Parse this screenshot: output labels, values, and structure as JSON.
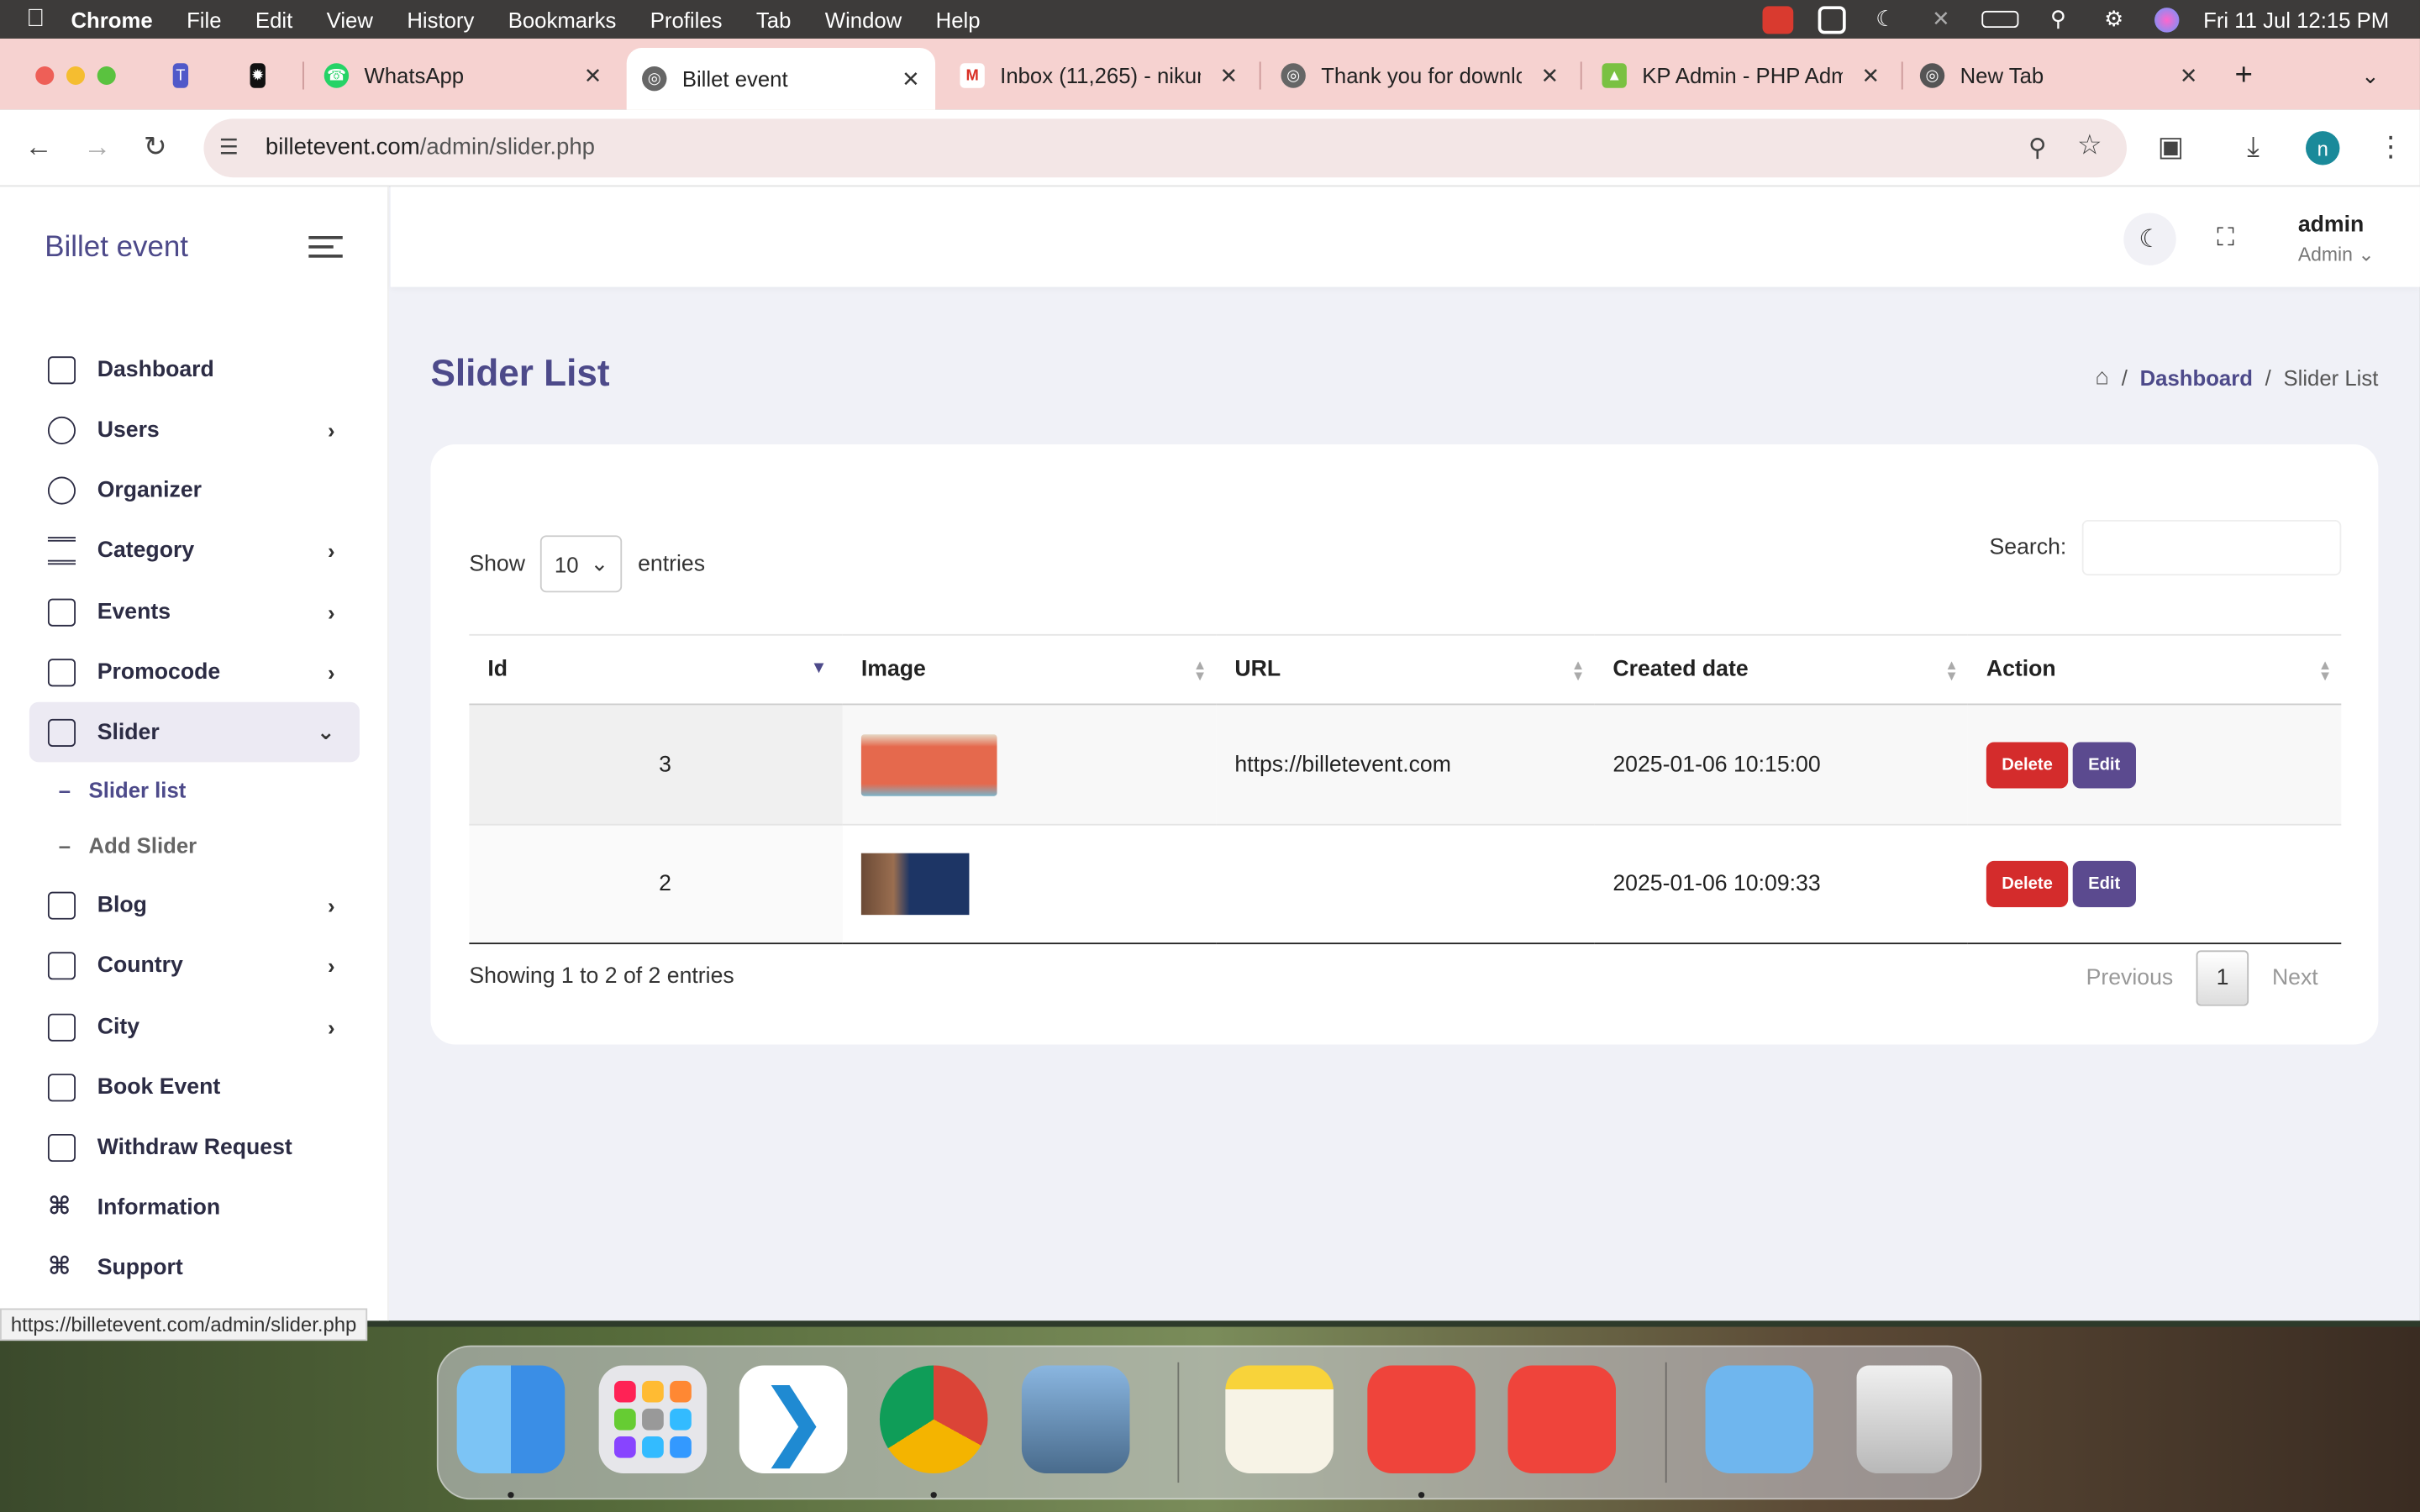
{
  "menubar": {
    "app": "Chrome",
    "items": [
      "File",
      "Edit",
      "View",
      "History",
      "Bookmarks",
      "Profiles",
      "Tab",
      "Window",
      "Help"
    ],
    "datetime": "Fri 11 Jul  12:15 PM"
  },
  "tabs": [
    {
      "label": "WhatsApp"
    },
    {
      "label": "Billet event"
    },
    {
      "label": "Inbox (11,265) - nikun"
    },
    {
      "label": "Thank you for downlo"
    },
    {
      "label": "KP Admin - PHP Adm"
    },
    {
      "label": "New Tab"
    }
  ],
  "browser": {
    "url_host": "billetevent.com",
    "url_path": "/admin/slider.php",
    "profile_initial": "n",
    "status_url": "https://billetevent.com/admin/slider.php"
  },
  "sidebar": {
    "brand": "Billet event",
    "items": [
      {
        "label": "Dashboard"
      },
      {
        "label": "Users"
      },
      {
        "label": "Organizer"
      },
      {
        "label": "Category"
      },
      {
        "label": "Events"
      },
      {
        "label": "Promocode"
      },
      {
        "label": "Slider"
      },
      {
        "label": "Blog"
      },
      {
        "label": "Country"
      },
      {
        "label": "City"
      },
      {
        "label": "Book Event"
      },
      {
        "label": "Withdraw Request"
      },
      {
        "label": "Information"
      },
      {
        "label": "Support"
      }
    ],
    "sub": {
      "slider_list": "Slider list",
      "add_slider": "Add Slider"
    }
  },
  "topbar": {
    "user_name": "admin",
    "user_role": "Admin"
  },
  "main": {
    "title": "Slider List",
    "breadcrumb": {
      "link": "Dashboard",
      "current": "Slider List",
      "sep": "/"
    },
    "show_label": "Show",
    "entries_label": "entries",
    "page_size": "10",
    "search_label": "Search:",
    "columns": [
      "Id",
      "Image",
      "URL",
      "Created date",
      "Action"
    ],
    "rows": [
      {
        "id": "3",
        "url": "https://billetevent.com",
        "created": "2025-01-06 10:15:00"
      },
      {
        "id": "2",
        "url": "",
        "created": "2025-01-06 10:09:33"
      }
    ],
    "delete_label": "Delete",
    "edit_label": "Edit",
    "info": "Showing 1 to 2 of 2 entries",
    "pager": {
      "prev": "Previous",
      "page": "1",
      "next": "Next"
    }
  },
  "colors": {
    "accent": "#4d4a8a",
    "danger": "#d42c2c",
    "edit": "#5b4a8f",
    "tabstrip": "#f6d2d0"
  }
}
